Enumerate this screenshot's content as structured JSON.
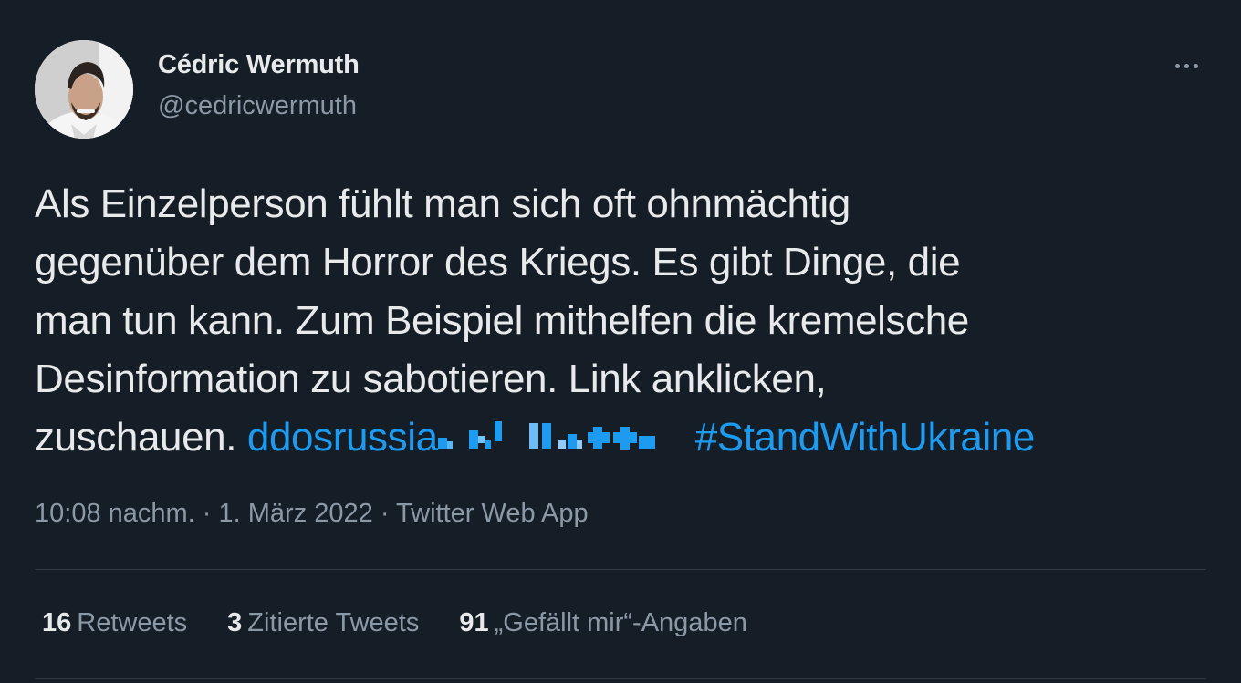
{
  "author": {
    "display_name": "Cédric Wermuth",
    "handle": "@cedricwermuth"
  },
  "icons": {
    "avatar": "profile-photo",
    "more": "more-options-icon"
  },
  "tweet": {
    "lines": [
      "Als Einzelperson fühlt man sich oft ohnmächtig",
      "gegenüber dem Horror des Kriegs. Es gibt Dinge, die",
      "man tun kann. Zum Beispiel mithelfen die kremelsche",
      "Desinformation zu sabotieren. Link anklicken,"
    ],
    "last_line_prefix": "zuschauen.",
    "link_text": "ddosrussia",
    "hashtag": "#StandWithUkraine"
  },
  "meta": {
    "time": "10:08 nachm.",
    "sep1": " · ",
    "date": "1. März 2022",
    "sep2": " · ",
    "source": "Twitter Web App"
  },
  "stats": {
    "retweets_count": "16",
    "retweets_label": "Retweets",
    "quotes_count": "3",
    "quotes_label": "Zitierte Tweets",
    "likes_count": "91",
    "likes_label": "„Gefällt mir“-Angaben"
  },
  "colors": {
    "background": "#151d27",
    "text": "#e7e9ea",
    "secondary": "#8b98a5",
    "link": "#1d9bf0",
    "divider": "#2f3a45"
  }
}
